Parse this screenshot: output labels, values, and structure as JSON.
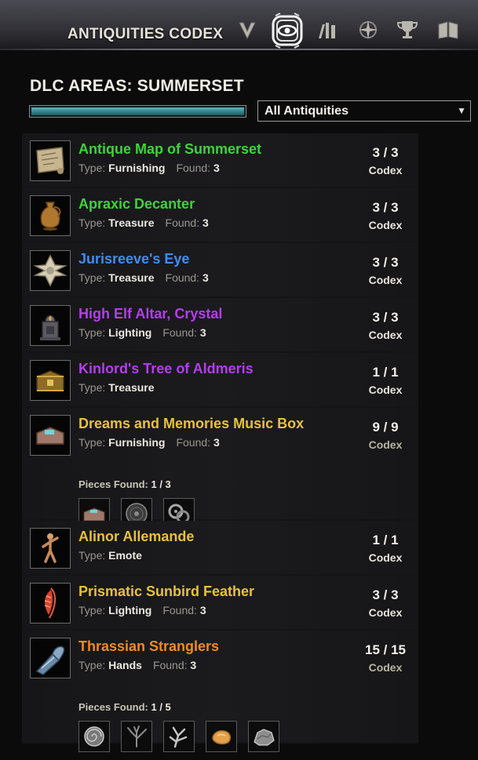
{
  "header": {
    "title": "ANTIQUITIES CODEX",
    "nav_icons": [
      "skills-icon",
      "antiquities-eye-icon",
      "leads-icon",
      "compass-icon",
      "trophy-icon",
      "codex-book-icon"
    ]
  },
  "page": {
    "title": "DLC AREAS: SUMMERSET",
    "progress_fraction": 1.0,
    "filter": {
      "selected": "All Antiquities"
    }
  },
  "colors": {
    "green": "#3fd33b",
    "blue": "#3f8df2",
    "purple": "#b43df0",
    "gold": "#e8c238",
    "orange": "#ef8a21",
    "progress": "#3a9aa2"
  },
  "items": [
    {
      "name": "Antique Map of Summerset",
      "quality": "green",
      "type_label": "Type:",
      "type": "Furnishing",
      "found_label": "Found:",
      "found": "3",
      "count": "3 / 3",
      "codex": "Codex",
      "icon": "map-icon"
    },
    {
      "name": "Apraxic Decanter",
      "quality": "green",
      "type_label": "Type:",
      "type": "Treasure",
      "found_label": "Found:",
      "found": "3",
      "count": "3 / 3",
      "codex": "Codex",
      "icon": "vase-icon"
    },
    {
      "name": "Jurisreeve's Eye",
      "quality": "blue",
      "type_label": "Type:",
      "type": "Treasure",
      "found_label": "Found:",
      "found": "3",
      "count": "3 / 3",
      "codex": "Codex",
      "icon": "cross-emblem-icon"
    },
    {
      "name": "High Elf Altar, Crystal",
      "quality": "purple",
      "type_label": "Type:",
      "type": "Lighting",
      "found_label": "Found:",
      "found": "3",
      "count": "3 / 3",
      "codex": "Codex",
      "icon": "altar-icon"
    },
    {
      "name": "Kinlord's Tree of Aldmeris",
      "quality": "purple",
      "type_label": "Type:",
      "type": "Treasure",
      "found_label": "",
      "found": "",
      "count": "1 / 1",
      "codex": "Codex",
      "icon": "chest-icon"
    },
    {
      "name": "Dreams and Memories Music Box",
      "quality": "gold",
      "type_label": "Type:",
      "type": "Furnishing",
      "found_label": "Found:",
      "found": "3",
      "count": "9 / 9",
      "codex": "Codex",
      "icon": "music-box-icon",
      "pieces_label": "Pieces Found:",
      "pieces_found": "1 / 3",
      "pieces": [
        "music-box-piece-icon",
        "disc-piece-icon",
        "gears-piece-icon"
      ]
    },
    {
      "name": "Alinor Allemande",
      "quality": "gold",
      "type_label": "Type:",
      "type": "Emote",
      "found_label": "",
      "found": "",
      "count": "1 / 1",
      "codex": "Codex",
      "icon": "dancer-icon"
    },
    {
      "name": "Prismatic Sunbird Feather",
      "quality": "gold",
      "type_label": "Type:",
      "type": "Lighting",
      "found_label": "Found:",
      "found": "3",
      "count": "3 / 3",
      "codex": "Codex",
      "icon": "feather-icon"
    },
    {
      "name": "Thrassian Stranglers",
      "quality": "orange",
      "type_label": "Type:",
      "type": "Hands",
      "found_label": "Found:",
      "found": "3",
      "count": "15 / 15",
      "codex": "Codex",
      "icon": "gauntlet-icon",
      "pieces_label": "Pieces Found:",
      "pieces_found": "1 / 5",
      "pieces": [
        "shell-piece-icon",
        "coral-piece-icon",
        "branch-piece-icon",
        "amber-piece-icon",
        "rock-piece-icon"
      ]
    }
  ]
}
